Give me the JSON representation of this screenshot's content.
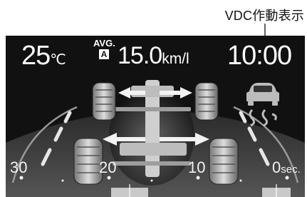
{
  "callout": {
    "label": "VDC作動表示"
  },
  "display": {
    "temperature": {
      "value": "25",
      "unit": "℃"
    },
    "avg_label": "AVG.",
    "avg_badge": "A",
    "fuel_economy": {
      "value": "15.0",
      "unit": "km/l"
    },
    "clock": "10:00"
  },
  "timeline": {
    "ticks": [
      "30",
      "20",
      "10",
      "0"
    ],
    "unit": "sec."
  },
  "icons": [
    "car-chassis-icon",
    "torque-arrow-icon",
    "vdc-skid-car-icon"
  ],
  "colors": {
    "screen_bg": "#111111",
    "text": "#ffffff",
    "bar": "#c9c9c9"
  }
}
